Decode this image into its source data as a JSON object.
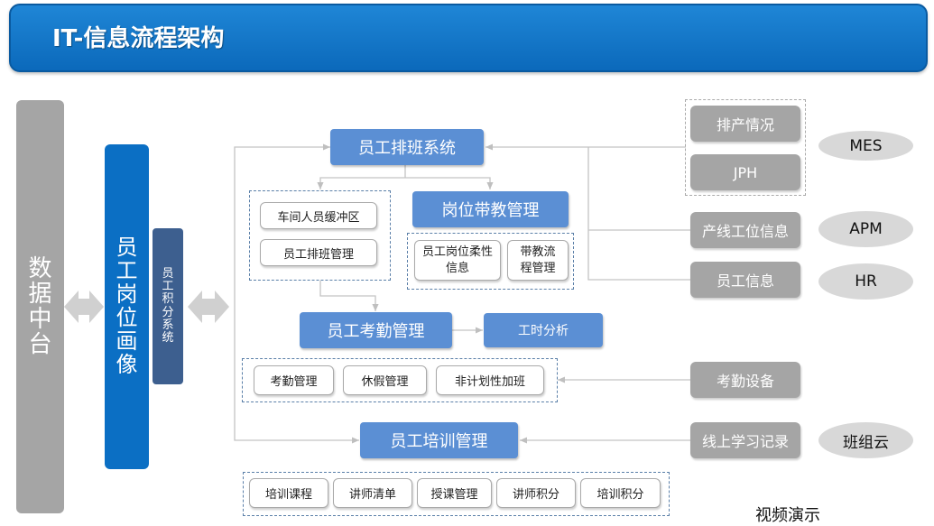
{
  "header": {
    "title": "IT-信息流程架构"
  },
  "left": {
    "data_center": [
      "数",
      "据",
      "中",
      "台"
    ],
    "portrait": [
      "员",
      "工",
      "岗",
      "位",
      "画",
      "像"
    ],
    "points_system": [
      "员",
      "工",
      "积",
      "分",
      "系",
      "统"
    ]
  },
  "center": {
    "scheduling": "员工排班系统",
    "workshop_buffer": "车间人员缓冲区",
    "schedule_mgmt": "员工排班管理",
    "mentoring": "岗位带教管理",
    "flex_info": "员工岗位柔性信息",
    "mentor_process": "带教流程管理",
    "attendance": "员工考勤管理",
    "hours_analysis": "工时分析",
    "attendance_items": [
      "考勤管理",
      "休假管理",
      "非计划性加班"
    ],
    "training": "员工培训管理",
    "training_items": [
      "培训课程",
      "讲师清单",
      "授课管理",
      "讲师积分",
      "培训积分"
    ]
  },
  "right": {
    "production_status": "排产情况",
    "jph": "JPH",
    "line_station": "产线工位信息",
    "employee_info": "员工信息",
    "attendance_device": "考勤设备",
    "online_learning": "线上学习记录"
  },
  "systems": {
    "mes": "MES",
    "apm": "APM",
    "hr": "HR",
    "banzuyun": "班组云"
  },
  "footer": {
    "video_demo": "视频演示"
  },
  "colors": {
    "header_blue": "#0b69bb",
    "box_blue": "#5b8fd4",
    "portrait_blue": "#0b6fc4",
    "points_navy": "#3d5f8f",
    "gray": "#a5a5a5"
  }
}
